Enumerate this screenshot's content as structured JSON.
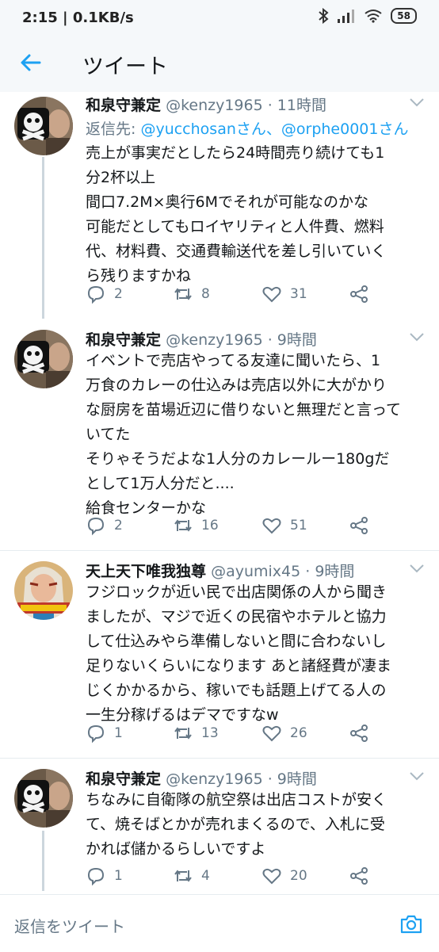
{
  "status_bar": {
    "time": "2:15",
    "speed": "0.1KB/s",
    "battery": "58"
  },
  "app_bar": {
    "title": "ツイート"
  },
  "tweets": [
    {
      "name": "和泉守兼定",
      "handle": "@kenzy1965 · 11時間",
      "reply_prefix": "返信先: ",
      "reply_to": "@yucchosanさん、@orphe0001さん",
      "lines": [
        "売上が事実だとしたら24時間売り続けても1",
        "分2杯以上",
        "間口7.2M×奥行6Mでそれが可能なのかな",
        "可能だとしてもロイヤリティと人件費、燃料",
        "代、材料費、交通費輸送代を差し引いていく",
        "ら残りますかね"
      ],
      "replies": "2",
      "retweets": "8",
      "likes": "31"
    },
    {
      "name": "和泉守兼定",
      "handle": "@kenzy1965 · 9時間",
      "lines": [
        "イベントで売店やってる友達に聞いたら、1",
        "万食のカレーの仕込みは売店以外に大がかり",
        "な厨房を苗場近辺に借りないと無理だと言って",
        "いてた",
        "そりゃそうだよな1人分のカレールー180gだ",
        "として1万人分だと....",
        "給食センターかな"
      ],
      "replies": "2",
      "retweets": "16",
      "likes": "51"
    },
    {
      "name": "天上天下唯我独尊",
      "handle": "@ayumix45 · 9時間",
      "lines": [
        "フジロックが近い民で出店関係の人から聞き",
        "ましたが、マジで近くの民宿やホテルと協力",
        "して仕込みやら準備しないと間に合わないし",
        "足りないくらいになります あと諸経費が凄ま",
        "じくかかるから、稼いでも話題上げてる人の",
        "一生分稼げるはデマですなw"
      ],
      "replies": "1",
      "retweets": "13",
      "likes": "26"
    },
    {
      "name": "和泉守兼定",
      "handle": "@kenzy1965 · 9時間",
      "lines": [
        "ちなみに自衛隊の航空祭は出店コストが安く",
        "て、焼そばとかが売れまくるので、入札に受",
        "かれば儲かるらしいですよ"
      ],
      "replies": "1",
      "retweets": "4",
      "likes": "20"
    }
  ],
  "composer": {
    "placeholder": "返信をツイート"
  },
  "colors": {
    "accent": "#1da1f2",
    "muted": "#657786",
    "text": "#14171a"
  }
}
